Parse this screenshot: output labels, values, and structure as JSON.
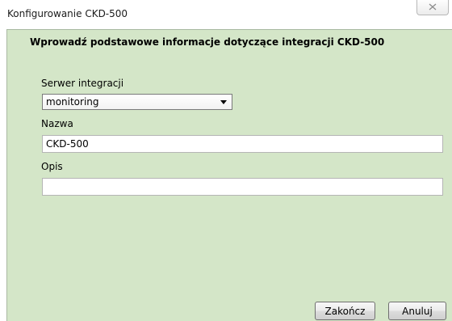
{
  "window": {
    "title": "Konfigurowanie CKD-500",
    "close_icon": "close-icon"
  },
  "content": {
    "header": "Wprowadź podstawowe informacje dotyczące integracji CKD-500",
    "server_label": "Serwer integracji",
    "server_selected": "monitoring",
    "name_label": "Nazwa",
    "name_value": "CKD-500",
    "description_label": "Opis",
    "description_value": ""
  },
  "buttons": {
    "finish_label": "Zakończ",
    "cancel_label": "Anuluj"
  },
  "colors": {
    "panel_background": "#d4e6c8",
    "window_background": "#ffffff"
  }
}
